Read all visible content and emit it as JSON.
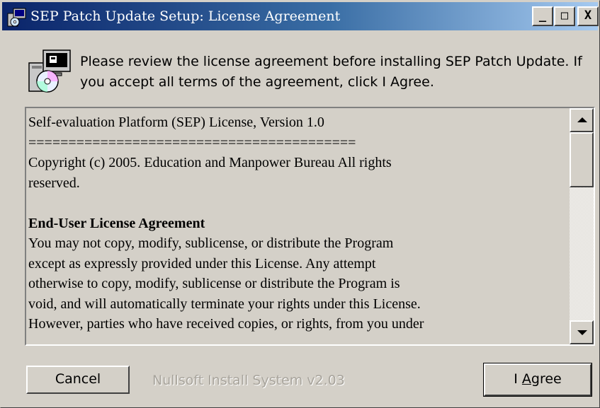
{
  "window": {
    "title": "SEP Patch Update Setup: License Agreement",
    "controls": {
      "minimize": "_",
      "maximize": "□",
      "close": "X"
    }
  },
  "header": {
    "text": "Please review the license agreement before installing SEP Patch Update. If you accept all terms of the agreement, click I Agree.",
    "icon": "installer-disk-icon"
  },
  "license": {
    "lines": [
      "Self-evaluation Platform (SEP) License, Version 1.0",
      "=========================================",
      "Copyright (c) 2005. Education and Manpower Bureau All rights",
      "reserved.",
      "",
      "End-User License Agreement",
      "You may not copy, modify, sublicense, or distribute the Program",
      "except as expressly provided under this License. Any attempt",
      "otherwise to copy, modify, sublicense or distribute the Program is",
      "void, and will automatically terminate your rights under this License.",
      "However, parties who have received copies, or rights, from you under"
    ]
  },
  "footer": {
    "cancel_label": "Cancel",
    "branding": "Nullsoft Install System v2.03",
    "agree_label_pre": "I ",
    "agree_label_accel": "A",
    "agree_label_post": "gree"
  },
  "colors": {
    "titlebar_start": "#0a246a",
    "titlebar_end": "#a6caf0",
    "face": "#d4d0c8"
  }
}
